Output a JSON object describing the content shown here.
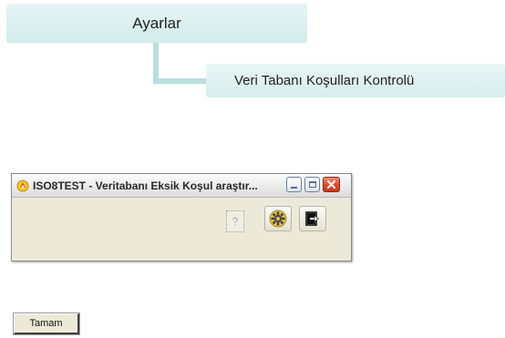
{
  "breadcrumb": {
    "root_label": "Ayarlar",
    "child_label": "Veri Tabanı Koşulları Kontrolü"
  },
  "window": {
    "title": "ISO8TEST - Veritabanı Eksik Koşul araştır...",
    "app_icon": "app-logo-icon",
    "caption_buttons": [
      "minimize",
      "maximize",
      "close"
    ],
    "toolbar": {
      "help_label": "?",
      "gear_icon": "gear-icon",
      "exit_icon": "exit-icon"
    }
  },
  "dialog": {
    "ok_label": "Tamam"
  },
  "colors": {
    "breadcrumb_bg": "#d6eded",
    "connector": "#b9dedd",
    "window_bg": "#ece9d8",
    "close_button": "#d84a2a"
  }
}
